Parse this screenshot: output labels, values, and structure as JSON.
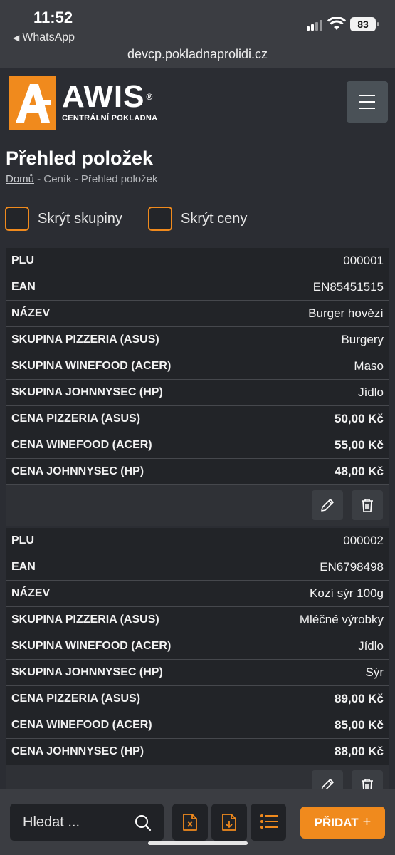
{
  "status_bar": {
    "time": "11:52",
    "back_app": "WhatsApp",
    "battery": "83",
    "url": "devcp.pokladnaprolidi.cz"
  },
  "brand": {
    "name": "AWIS",
    "registered": "®",
    "subtitle": "CENTRÁLNÍ POKLADNA",
    "accent_color": "#f08a1d"
  },
  "page": {
    "title": "Přehled položek"
  },
  "breadcrumb": {
    "home": "Domů",
    "sep1": " - ",
    "pricelist": "Ceník",
    "sep2": " - ",
    "current": "Přehled položek"
  },
  "filters": {
    "hide_groups": "Skrýt skupiny",
    "hide_prices": "Skrýt ceny"
  },
  "items": [
    {
      "rows": [
        {
          "label": "PLU",
          "value": "000001"
        },
        {
          "label": "EAN",
          "value": "EN85451515"
        },
        {
          "label": "NÁZEV",
          "value": "Burger hovězí"
        },
        {
          "label": "SKUPINA PIZZERIA (ASUS)",
          "value": "Burgery"
        },
        {
          "label": "SKUPINA WINEFOOD (ACER)",
          "value": "Maso"
        },
        {
          "label": "SKUPINA JOHNNYSEC (HP)",
          "value": "Jídlo"
        },
        {
          "label": "CENA PIZZERIA (ASUS)",
          "value": "50,00 Kč"
        },
        {
          "label": "CENA WINEFOOD (ACER)",
          "value": "55,00 Kč"
        },
        {
          "label": "CENA JOHNNYSEC (HP)",
          "value": "48,00 Kč"
        }
      ]
    },
    {
      "rows": [
        {
          "label": "PLU",
          "value": "000002"
        },
        {
          "label": "EAN",
          "value": "EN6798498"
        },
        {
          "label": "NÁZEV",
          "value": "Kozí sýr 100g"
        },
        {
          "label": "SKUPINA PIZZERIA (ASUS)",
          "value": "Mléčné výrobky"
        },
        {
          "label": "SKUPINA WINEFOOD (ACER)",
          "value": "Jídlo"
        },
        {
          "label": "SKUPINA JOHNNYSEC (HP)",
          "value": "Sýr"
        },
        {
          "label": "CENA PIZZERIA (ASUS)",
          "value": "89,00 Kč"
        },
        {
          "label": "CENA WINEFOOD (ACER)",
          "value": "85,00 Kč"
        },
        {
          "label": "CENA JOHNNYSEC (HP)",
          "value": "88,00 Kč"
        }
      ]
    }
  ],
  "toolbar": {
    "search_placeholder": "Hledat ...",
    "add_label": "PŘIDAT",
    "add_plus": "+",
    "icons": [
      "search-icon",
      "export-excel-icon",
      "import-file-icon",
      "list-icon"
    ]
  }
}
